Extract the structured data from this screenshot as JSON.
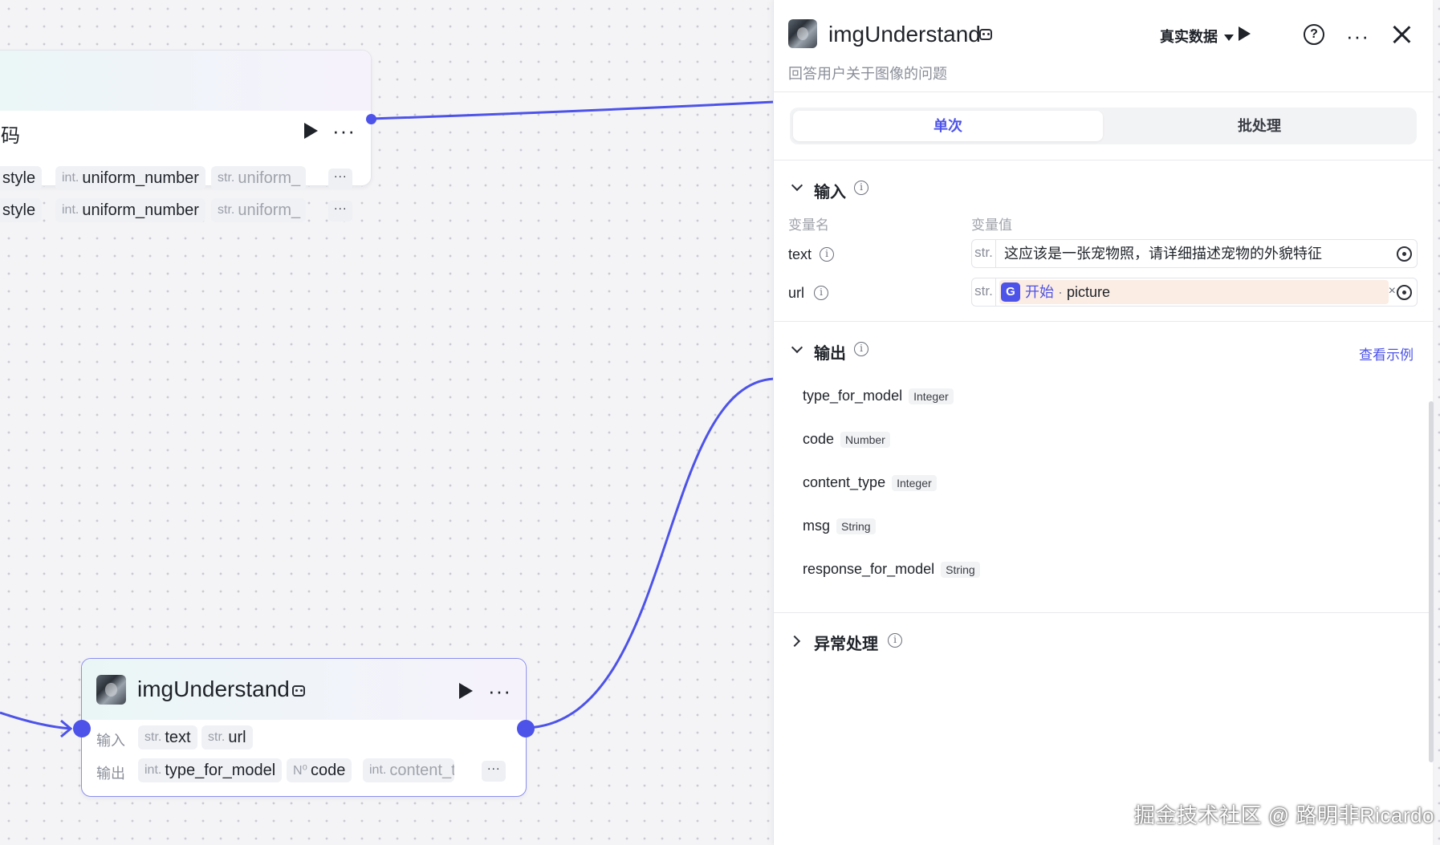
{
  "canvas": {
    "top_node": {
      "title_fragment": "码",
      "rows": [
        {
          "lead": "style",
          "items": [
            {
              "type": "int.",
              "name": "uniform_number"
            },
            {
              "type": "str.",
              "name": "uniform_"
            }
          ]
        },
        {
          "lead": "style",
          "items": [
            {
              "type": "int.",
              "name": "uniform_number"
            },
            {
              "type": "str.",
              "name": "uniform_"
            }
          ]
        }
      ],
      "more": "···"
    },
    "img_node": {
      "title": "imgUnderstand",
      "input_label": "输入",
      "output_label": "输出",
      "inputs": [
        {
          "type": "str.",
          "name": "text"
        },
        {
          "type": "str.",
          "name": "url"
        }
      ],
      "outputs": [
        {
          "type": "int.",
          "name": "type_for_model"
        },
        {
          "type": "N⁰",
          "name": "code"
        },
        {
          "type": "int.",
          "name": "content_t"
        }
      ],
      "more": "···"
    }
  },
  "panel": {
    "title": "imgUnderstand",
    "description": "回答用户关于图像的问题",
    "dataset_label": "真实数据",
    "help_glyph": "?",
    "more_glyph": "···",
    "tabs": {
      "single": "单次",
      "batch": "批处理"
    },
    "input_section": {
      "title": "输入",
      "col_name": "变量名",
      "col_value": "变量值",
      "vars": [
        {
          "name": "text",
          "type": "str.",
          "value": "这应该是一张宠物照，请详细描述宠物的外貌特征"
        },
        {
          "name": "url",
          "type": "str.",
          "ref_source": "开始",
          "ref_sep": "·",
          "ref_name": "picture",
          "clear": "×"
        }
      ]
    },
    "output_section": {
      "title": "输出",
      "view_example": "查看示例",
      "fields": [
        {
          "name": "type_for_model",
          "type": "Integer"
        },
        {
          "name": "code",
          "type": "Number"
        },
        {
          "name": "content_type",
          "type": "Integer"
        },
        {
          "name": "msg",
          "type": "String"
        },
        {
          "name": "response_for_model",
          "type": "String"
        }
      ]
    },
    "exception_section": {
      "title": "异常处理"
    }
  },
  "watermark": "掘金技术社区 @ 路明非Ricardo",
  "colors": {
    "accent": "#4d53e8",
    "canvas_bg": "#f4f4f6",
    "ref_chip_bg": "#fbece4"
  }
}
